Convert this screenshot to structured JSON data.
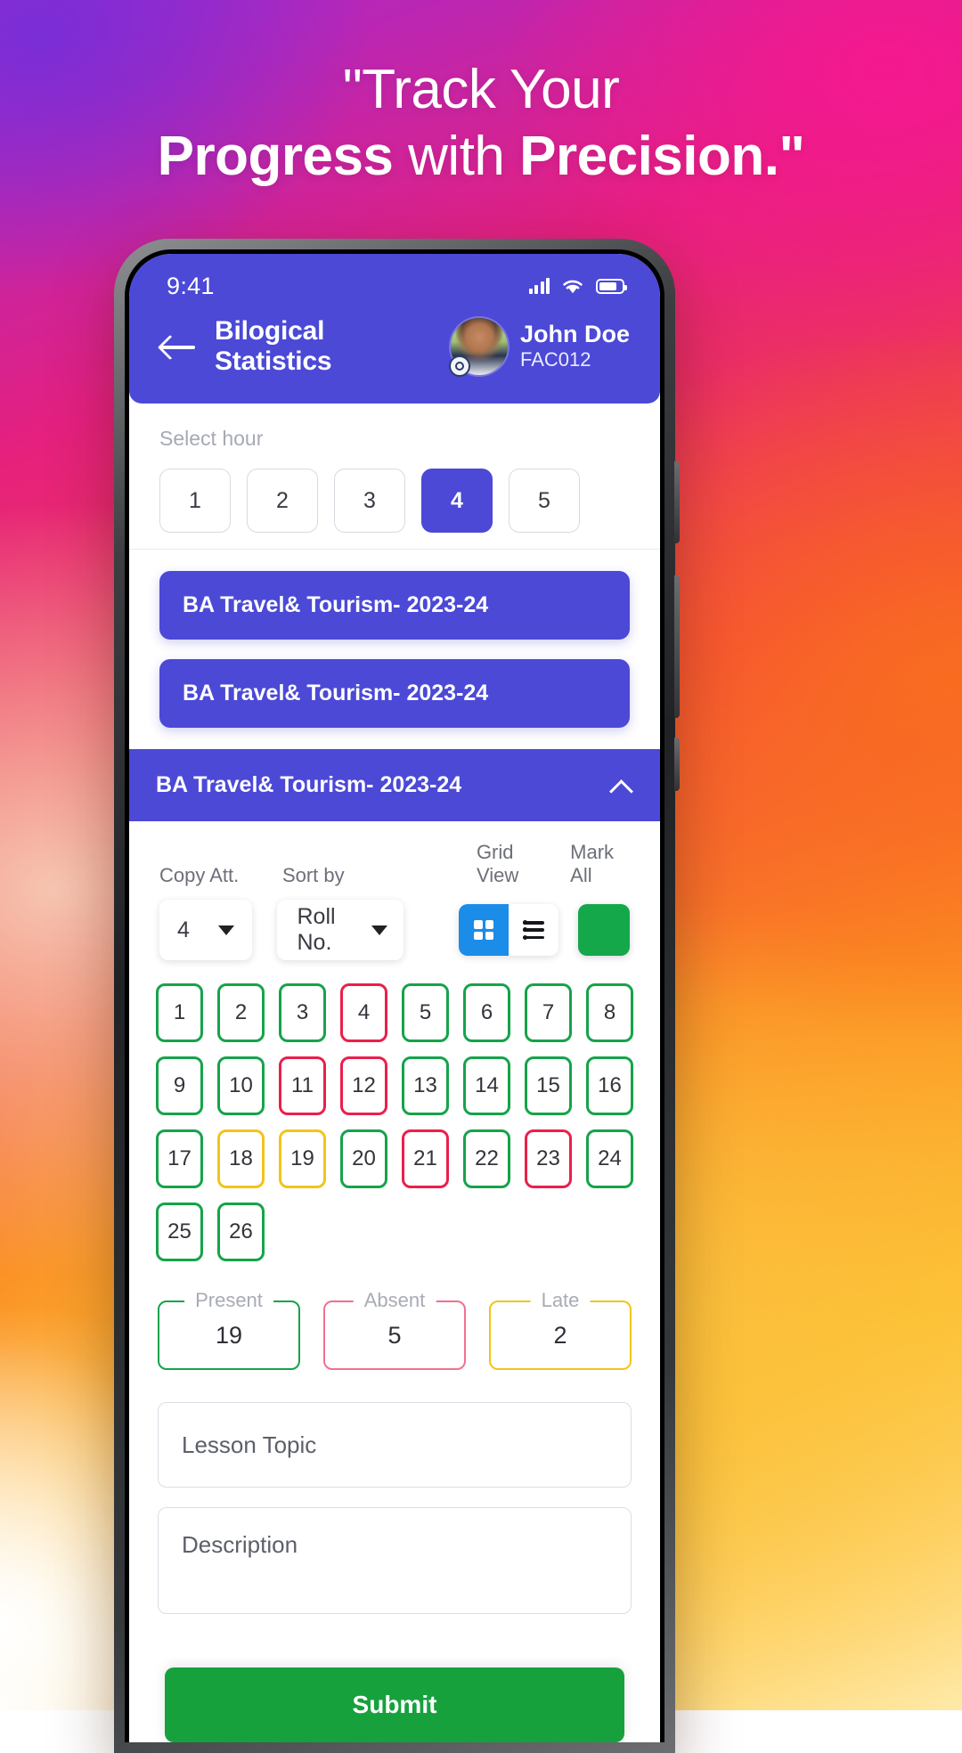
{
  "promo": {
    "headline_line1": "\"Track Your",
    "headline_line2_bold1": "Progress",
    "headline_line2_regular": " with ",
    "headline_line2_bold2": "Precision.\""
  },
  "status_bar": {
    "time": "9:41",
    "signal_icon": "signal-bars-icon",
    "wifi_icon": "wifi-icon",
    "battery_icon": "battery-icon"
  },
  "app_bar": {
    "back_icon": "back-arrow-icon",
    "title": "Bilogical Statistics",
    "user_name": "John Doe",
    "user_id": "FAC012",
    "avatar_icon": "avatar-image"
  },
  "hour_selector": {
    "label": "Select hour",
    "options": [
      "1",
      "2",
      "3",
      "4",
      "5"
    ],
    "selected": "4"
  },
  "classes": {
    "pills": [
      "BA Travel& Tourism- 2023-24",
      "BA Travel& Tourism- 2023-24"
    ],
    "expanded_title": "BA Travel& Tourism- 2023-24",
    "collapse_icon": "chevron-up-icon"
  },
  "toolbar": {
    "copy_label": "Copy Att.",
    "copy_value": "4",
    "sort_label": "Sort by",
    "sort_value": "Roll No.",
    "view_label": "Grid View",
    "grid_icon": "grid-view-icon",
    "list_icon": "list-view-icon",
    "view_selected": "grid",
    "mark_all_label": "Mark All",
    "mark_all_color": "#15a84a"
  },
  "colors": {
    "primary": "#4b49d6",
    "present": "#16a34a",
    "absent": "#ea1f4b",
    "late": "#f2c419",
    "submit": "#17a13d",
    "grid_active": "#1b8ce8"
  },
  "students": [
    {
      "n": "1",
      "state": "present"
    },
    {
      "n": "2",
      "state": "present"
    },
    {
      "n": "3",
      "state": "present"
    },
    {
      "n": "4",
      "state": "absent"
    },
    {
      "n": "5",
      "state": "present"
    },
    {
      "n": "6",
      "state": "present"
    },
    {
      "n": "7",
      "state": "present"
    },
    {
      "n": "8",
      "state": "present"
    },
    {
      "n": "9",
      "state": "present"
    },
    {
      "n": "10",
      "state": "present"
    },
    {
      "n": "11",
      "state": "absent"
    },
    {
      "n": "12",
      "state": "absent"
    },
    {
      "n": "13",
      "state": "present"
    },
    {
      "n": "14",
      "state": "present"
    },
    {
      "n": "15",
      "state": "present"
    },
    {
      "n": "16",
      "state": "present"
    },
    {
      "n": "17",
      "state": "present"
    },
    {
      "n": "18",
      "state": "late"
    },
    {
      "n": "19",
      "state": "late"
    },
    {
      "n": "20",
      "state": "present"
    },
    {
      "n": "21",
      "state": "absent"
    },
    {
      "n": "22",
      "state": "present"
    },
    {
      "n": "23",
      "state": "absent"
    },
    {
      "n": "24",
      "state": "present"
    },
    {
      "n": "25",
      "state": "present"
    },
    {
      "n": "26",
      "state": "present"
    }
  ],
  "summary": [
    {
      "label": "Present",
      "value": "19",
      "tone": "green"
    },
    {
      "label": "Absent",
      "value": "5",
      "tone": "red"
    },
    {
      "label": "Late",
      "value": "2",
      "tone": "yellow"
    }
  ],
  "fields": {
    "lesson_topic_placeholder": "Lesson Topic",
    "description_placeholder": "Description"
  },
  "submit": {
    "label": "Submit"
  }
}
